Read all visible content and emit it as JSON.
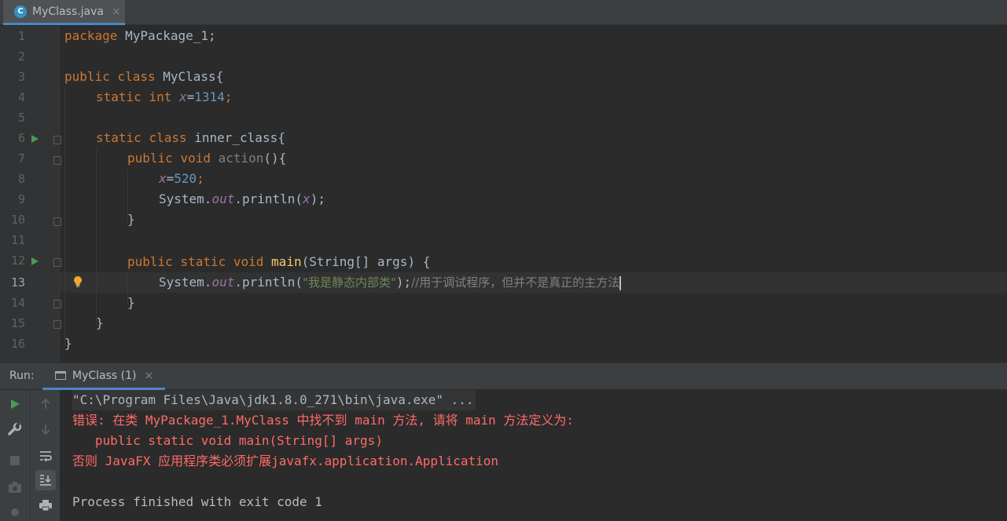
{
  "editor_tab": {
    "icon": "C",
    "label": "MyClass.java",
    "close": "×"
  },
  "code": {
    "line_numbers": [
      "1",
      "2",
      "3",
      "4",
      "5",
      "6",
      "7",
      "8",
      "9",
      "10",
      "11",
      "12",
      "13",
      "14",
      "15",
      "16"
    ],
    "l1": {
      "kw": "package",
      "rest": " MyPackage_1;"
    },
    "l3": {
      "kw1": "public",
      "kw2": "class",
      "name": " MyClass{"
    },
    "l4": {
      "kw1": "static",
      "kw2": "int",
      "field": "x",
      "eq": "=",
      "num": "1314",
      "semi": ";"
    },
    "l6": {
      "kw1": "static",
      "kw2": "class",
      "name": " inner_class{"
    },
    "l7": {
      "kw1": "public",
      "kw2": "void",
      "name": "action",
      "rest": "(){"
    },
    "l8": {
      "field": "x",
      "eq": "=",
      "num": "520",
      "semi": ";"
    },
    "l9": {
      "pre": "System.",
      "field": "out",
      "mid": ".println(",
      "arg": "x",
      "post": ");"
    },
    "l10": {
      "text": "}"
    },
    "l12": {
      "kw1": "public",
      "kw2": "static",
      "kw3": "void",
      "fn": "main",
      "rest": "(String[] args) {"
    },
    "l13": {
      "pre": "System.",
      "field": "out",
      "mid": ".println(",
      "str": "\"我是静态内部类\"",
      "post": ");",
      "comment": "//用于调试程序，但并不是真正的主方法"
    },
    "l14": {
      "text": "}"
    },
    "l15": {
      "text": "}"
    },
    "l16": {
      "text": "}"
    }
  },
  "run_panel": {
    "label": "Run:",
    "tab_label": "MyClass (1)",
    "tab_close": "×",
    "console": {
      "command": "\"C:\\Program Files\\Java\\jdk1.8.0_271\\bin\\java.exe\" ...",
      "error1": "错误: 在类 MyPackage_1.MyClass 中找不到 main 方法, 请将 main 方法定义为:",
      "error2": "   public static void main(String[] args)",
      "error3": "否则 JavaFX 应用程序类必须扩展javafx.application.Application",
      "exit": "Process finished with exit code 1"
    }
  },
  "colors": {
    "keyword": "#cc7832",
    "number": "#6897bb",
    "field": "#9876aa",
    "method": "#ffc66d",
    "string": "#6a8759",
    "comment": "#808080",
    "error": "#ff6b68",
    "run_green": "#499c54",
    "accent": "#4a88c7"
  },
  "icons": [
    "java-class-icon",
    "close-icon",
    "run-gutter-icon",
    "fold-icon",
    "lightbulb-icon",
    "rerun-icon",
    "wrench-icon",
    "stop-icon",
    "camera-icon",
    "up-arrow-icon",
    "down-arrow-icon",
    "soft-wrap-icon",
    "scroll-to-end-icon",
    "print-icon"
  ]
}
